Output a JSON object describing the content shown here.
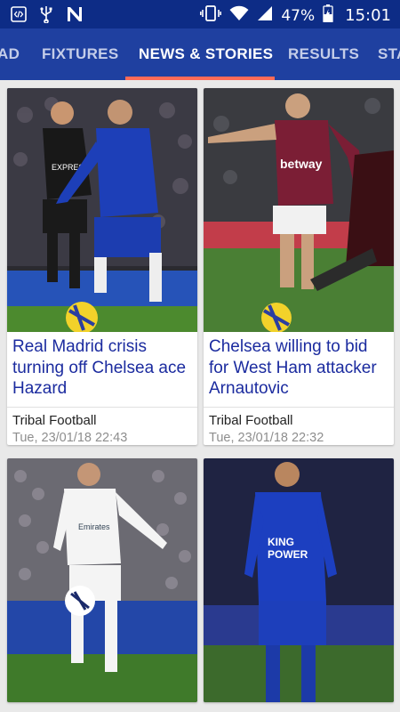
{
  "status_bar": {
    "icons": [
      "code-icon",
      "usb-icon",
      "n-logo-icon",
      "vibrate-icon",
      "wifi-icon",
      "signal-icon",
      "battery-icon"
    ],
    "battery": "47%",
    "time": "15:01"
  },
  "tabs": {
    "items": [
      {
        "label": "AD"
      },
      {
        "label": "FIXTURES"
      },
      {
        "label": "NEWS & STORIES"
      },
      {
        "label": "RESULTS"
      },
      {
        "label": "STA"
      }
    ],
    "active": "NEWS & STORIES",
    "indicator_color": "#ff6b57",
    "bar_color": "#1f40a0"
  },
  "articles": [
    {
      "title": "Real Madrid crisis turning off Chelsea ace Hazard",
      "source": "Tribal Football",
      "date": "Tue, 23/01/18 22:43"
    },
    {
      "title": "Chelsea willing to bid for West Ham attacker Arnautovic",
      "source": "Tribal Football",
      "date": "Tue, 23/01/18 22:32"
    },
    {
      "title": "",
      "source": "",
      "date": ""
    },
    {
      "title": "",
      "source": "",
      "date": ""
    }
  ],
  "colors": {
    "status_bar": "#0d2c86",
    "title_text": "#1b2b9f",
    "date_text": "#8e8e8e"
  }
}
